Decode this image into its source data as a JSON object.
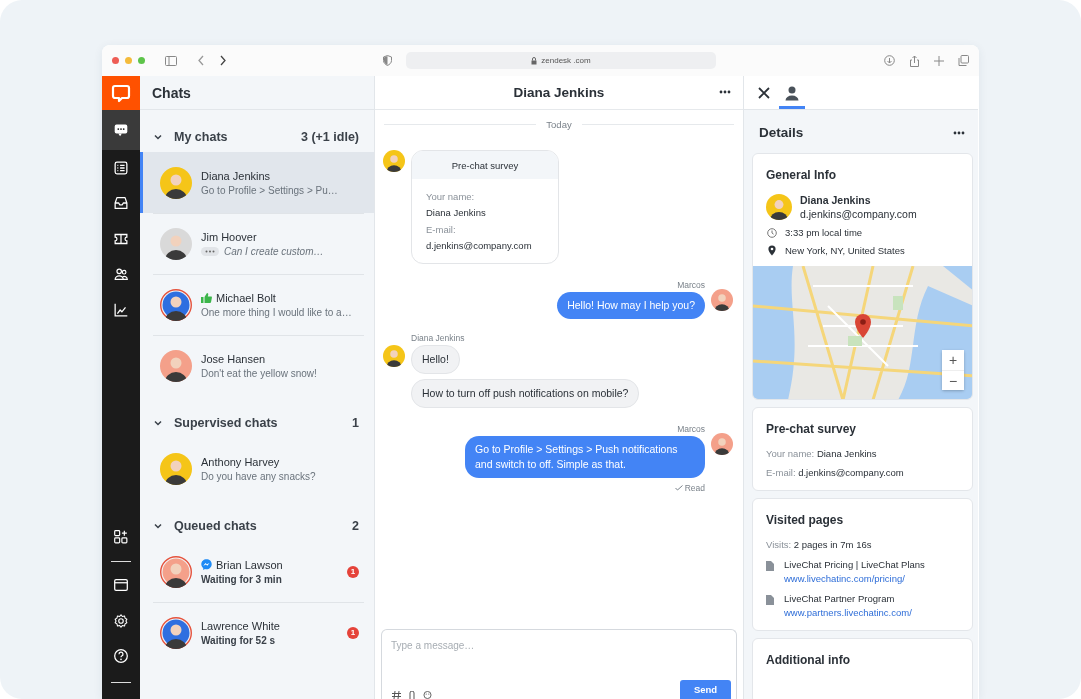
{
  "browser": {
    "url": "zendesk .com"
  },
  "nav_rail": {
    "top": [
      {
        "kind": "chats",
        "selected": true
      },
      {
        "kind": "list",
        "selected": false
      },
      {
        "kind": "inbox",
        "selected": false
      },
      {
        "kind": "ticket",
        "selected": false
      },
      {
        "kind": "people",
        "selected": false
      },
      {
        "kind": "chart",
        "selected": false
      }
    ],
    "bottom": [
      {
        "kind": "apps",
        "selected": false
      },
      {
        "kind": "window",
        "selected": false
      },
      {
        "kind": "settings",
        "selected": false
      },
      {
        "kind": "help",
        "selected": false
      }
    ]
  },
  "chat_list": {
    "title": "Chats",
    "sections": [
      {
        "title": "My chats",
        "count": "3 (+1 idle)",
        "kind": "mine",
        "expanded": true,
        "chats": [
          {
            "name": "Diana Jenkins",
            "preview": "Go to Profile > Settings > Pu…",
            "kind": "plain",
            "selected": true,
            "color": "#f5c518",
            "ring": false
          },
          {
            "name": "Jim Hoover",
            "preview": "Can I create custom…",
            "kind": "typing",
            "selected": false,
            "color": "#d9d9d9",
            "ring": false
          },
          {
            "name": "Michael Bolt",
            "preview": "One more thing I would like to a…",
            "kind": "liked",
            "selected": false,
            "color": "#2f6fe0",
            "ring": true
          },
          {
            "name": "Jose Hansen",
            "preview": "Don't eat the yellow snow!",
            "kind": "plain",
            "selected": false,
            "color": "#f4a08a",
            "ring": false
          }
        ]
      },
      {
        "title": "Supervised chats",
        "count": "1",
        "kind": "supervised",
        "expanded": true,
        "chats": [
          {
            "name": "Anthony Harvey",
            "preview": "Do you have any snacks?",
            "kind": "plain",
            "selected": false,
            "color": "#f5c518",
            "ring": false
          }
        ]
      },
      {
        "title": "Queued chats",
        "count": "2",
        "kind": "queued",
        "expanded": true,
        "chats": [
          {
            "name": "Brian Lawson",
            "preview": "Waiting for 3 min",
            "kind": "messenger",
            "selected": false,
            "color": "#f4a08a",
            "ring": true,
            "unread": "1"
          },
          {
            "name": "Lawrence White",
            "preview": "Waiting for 52 s",
            "kind": "plain",
            "selected": false,
            "color": "#2f6fe0",
            "ring": true,
            "unread": "1"
          }
        ]
      }
    ]
  },
  "conversation": {
    "title": "Diana Jenkins",
    "date": "Today",
    "messages": [
      {
        "kind": "survey",
        "title": "Pre-chat survey",
        "fields": [
          {
            "label": "Your name:",
            "value": "Diana Jenkins"
          },
          {
            "label": "E-mail:",
            "value": "d.jenkins@company.com"
          }
        ]
      },
      {
        "kind": "outgoing",
        "author": "Marcos",
        "bubbles": [
          "Hello! How may I help you?"
        ]
      },
      {
        "kind": "incoming",
        "author": "Diana Jenkins",
        "bubbles": [
          "Hello!",
          "How to turn off push notifications on mobile?"
        ]
      },
      {
        "kind": "outgoing",
        "author": "Marcos",
        "bubbles": [
          "Go to Profile > Settings > Push notifications and switch to off. Simple as that."
        ],
        "status": "Read"
      }
    ],
    "composer": {
      "placeholder": "Type a message…",
      "send": "Send"
    }
  },
  "details": {
    "tabs": [
      {
        "kind": "close",
        "selected": false
      },
      {
        "kind": "person",
        "selected": true
      }
    ],
    "title": "Details",
    "general": {
      "title": "General Info",
      "name": "Diana Jenkins",
      "email": "d.jenkins@company.com",
      "local_time": "3:33 pm local time",
      "location": "New York, NY, United States",
      "map": {
        "kind": "picture",
        "zoom_in": "+",
        "zoom_out": "−"
      }
    },
    "survey": {
      "title": "Pre-chat survey",
      "fields": [
        {
          "label": "Your name:",
          "value": "Diana Jenkins"
        },
        {
          "label": "E-mail:",
          "value": "d.jenkins@company.com"
        }
      ]
    },
    "visited": {
      "title": "Visited pages",
      "visits_label": "Visits:",
      "visits": "2 pages in 7m 16s",
      "pages": [
        {
          "title": "LiveChat Pricing | LiveChat Plans",
          "url": "www.livechatinc.com/pricing/"
        },
        {
          "title": "LiveChat Partner Program",
          "url": "www.partners.livechatinc.com/"
        }
      ]
    },
    "additional": {
      "title": "Additional info"
    }
  }
}
